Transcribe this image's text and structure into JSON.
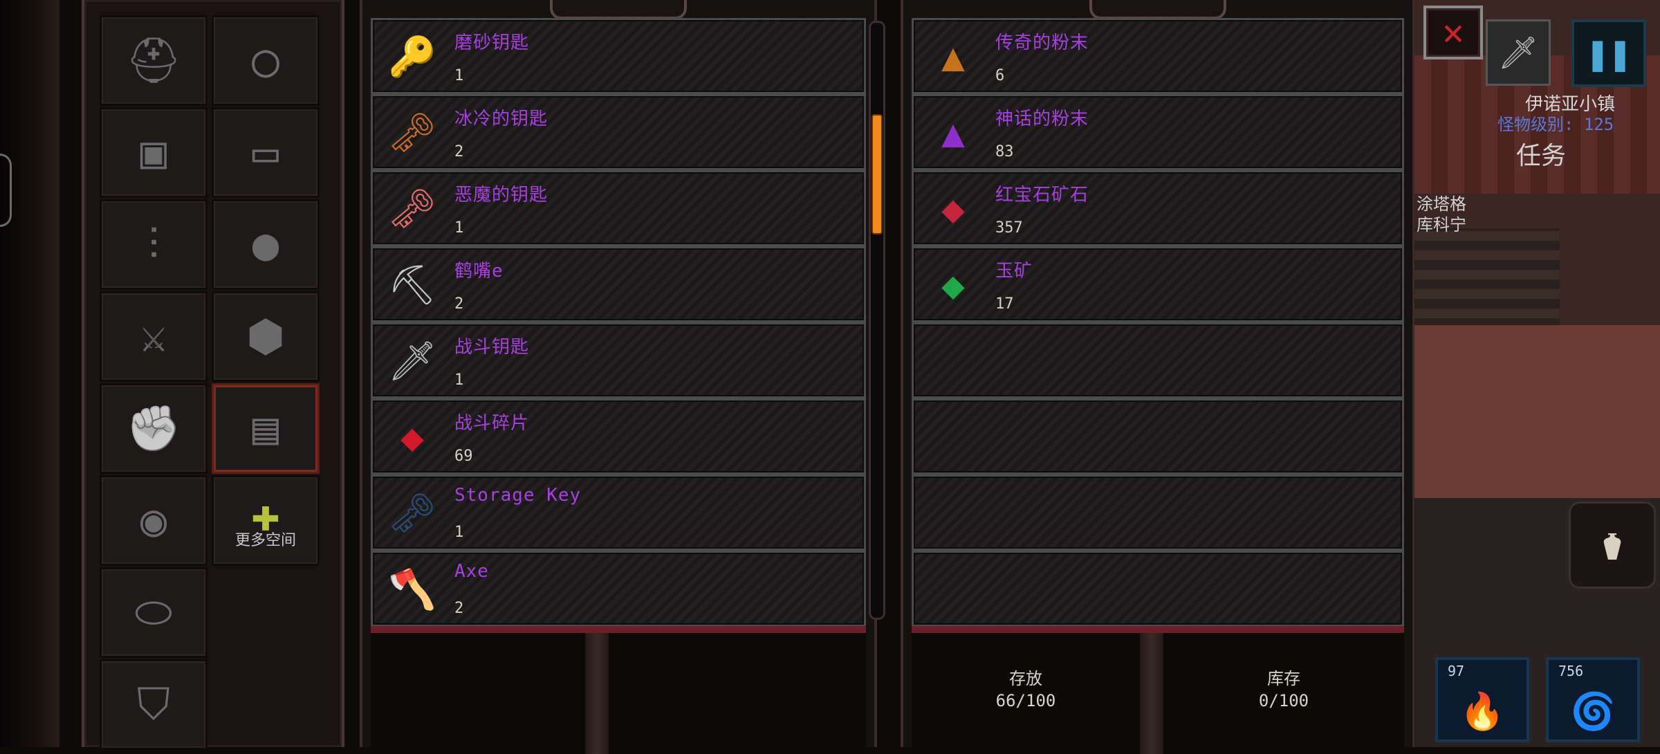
{
  "equipment_slots": [
    {
      "name": "helmet-slot",
      "icon": "⛑",
      "col": 0,
      "row": 0
    },
    {
      "name": "ring-slot",
      "icon": "◯",
      "col": 1,
      "row": 0
    },
    {
      "name": "armor-slot",
      "icon": "▣",
      "col": 0,
      "row": 1
    },
    {
      "name": "belt-slot",
      "icon": "▭",
      "col": 1,
      "row": 1
    },
    {
      "name": "boots-slot",
      "icon": "⫶",
      "col": 0,
      "row": 2
    },
    {
      "name": "bomb-slot",
      "icon": "●",
      "col": 1,
      "row": 2
    },
    {
      "name": "weapon-slot",
      "icon": "⚔",
      "col": 0,
      "row": 3
    },
    {
      "name": "offhand-helmet-slot",
      "icon": "⬢",
      "col": 1,
      "row": 3
    },
    {
      "name": "gloves-slot",
      "icon": "✊",
      "col": 0,
      "row": 4
    },
    {
      "name": "chest-slot",
      "icon": "▤",
      "col": 1,
      "row": 4,
      "selected": true
    },
    {
      "name": "amulet-slot",
      "icon": "◉",
      "col": 0,
      "row": 5
    },
    {
      "name": "more-space-slot",
      "icon": "✚",
      "col": 1,
      "row": 5,
      "label": "更多空间"
    },
    {
      "name": "bracelet-slot",
      "icon": "⬭",
      "col": 0,
      "row": 6
    },
    {
      "name": "shield-slot",
      "icon": "⛉",
      "col": 0,
      "row": 7
    }
  ],
  "inventory": {
    "items": [
      {
        "name": "磨砂钥匙",
        "count": "1",
        "icon": "🔑",
        "color": "#3fb7e0"
      },
      {
        "name": "冰冷的钥匙",
        "count": "2",
        "icon": "🗝",
        "color": "#c66a2e"
      },
      {
        "name": "恶魔的钥匙",
        "count": "1",
        "icon": "🗝",
        "color": "#e36a6a"
      },
      {
        "name": "鹤嘴e",
        "count": "2",
        "icon": "⛏",
        "color": "#c8c8c8"
      },
      {
        "name": "战斗钥匙",
        "count": "1",
        "icon": "🗡",
        "color": "#b9b9b9"
      },
      {
        "name": "战斗碎片",
        "count": "69",
        "icon": "◆",
        "color": "#d0192b"
      },
      {
        "name": "Storage Key",
        "count": "1",
        "icon": "🗝",
        "color": "#2b4a78"
      },
      {
        "name": "Axe",
        "count": "2",
        "icon": "🪓",
        "color": "#b56b5b"
      }
    ],
    "footer_left": "",
    "footer_right": ""
  },
  "storage": {
    "items": [
      {
        "name": "传奇的粉末",
        "count": "6",
        "icon": "▲",
        "color": "#c7721c"
      },
      {
        "name": "神话的粉末",
        "count": "83",
        "icon": "▲",
        "color": "#8d2fc8"
      },
      {
        "name": "红宝石矿石",
        "count": "357",
        "icon": "◆",
        "color": "#c4243c"
      },
      {
        "name": "玉矿",
        "count": "17",
        "icon": "◆",
        "color": "#1fa84a"
      },
      {
        "name": "",
        "count": "",
        "icon": "",
        "color": ""
      },
      {
        "name": "",
        "count": "",
        "icon": "",
        "color": ""
      },
      {
        "name": "",
        "count": "",
        "icon": "",
        "color": ""
      },
      {
        "name": "",
        "count": "",
        "icon": "",
        "color": ""
      }
    ],
    "stat_store_label": "存放",
    "stat_store_value": "66/100",
    "stat_stock_label": "库存",
    "stat_stock_value": "0/100"
  },
  "hud": {
    "close_icon": "✕",
    "sword_icon": "🗡",
    "pause_icon": "❚❚",
    "town": "伊诺亚小镇",
    "monster_level": "怪物级别: 125",
    "quest": "任务",
    "quest_line1": "涂塔格",
    "quest_line2": "库科宁",
    "potion_icon": "⚱",
    "skill1_count": "97",
    "skill2_count": "756"
  }
}
